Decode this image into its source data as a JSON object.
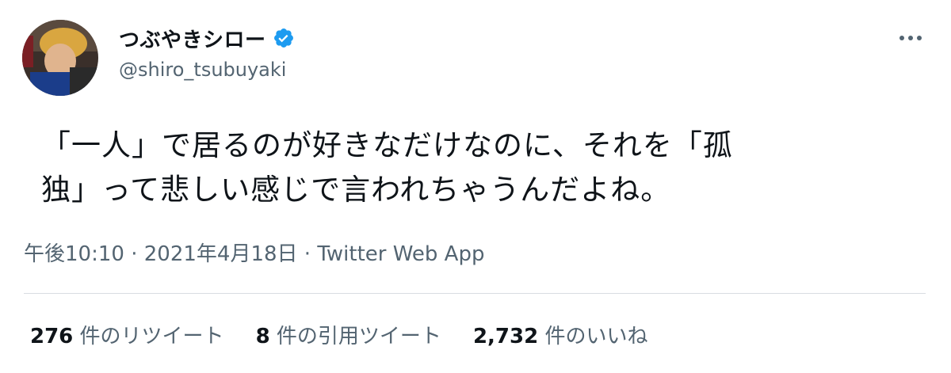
{
  "user": {
    "display_name": "つぶやきシロー",
    "handle": "@shiro_tsubuyaki",
    "verified": true,
    "avatar_icon": "user-avatar-photo"
  },
  "tweet": {
    "text_lines": [
      "「一人」で居るのが好きなだけなのに、それを「孤",
      "独」って悲しい感じで言われちゃうんだよね。"
    ],
    "time": "午後10:10",
    "separator": " · ",
    "date": "2021年4月18日",
    "source": "Twitter Web App"
  },
  "stats": {
    "retweets": {
      "count": "276",
      "label": "件のリツイート"
    },
    "quotes": {
      "count": "8",
      "label": "件の引用ツイート"
    },
    "likes": {
      "count": "2,732",
      "label": "件のいいね"
    }
  },
  "icons": {
    "verified": "verified-badge-icon",
    "more": "more-options-icon"
  },
  "colors": {
    "text_primary": "#0f1419",
    "text_secondary": "#536471",
    "verified_blue": "#1d9bf0",
    "divider": "#d9dde1"
  }
}
